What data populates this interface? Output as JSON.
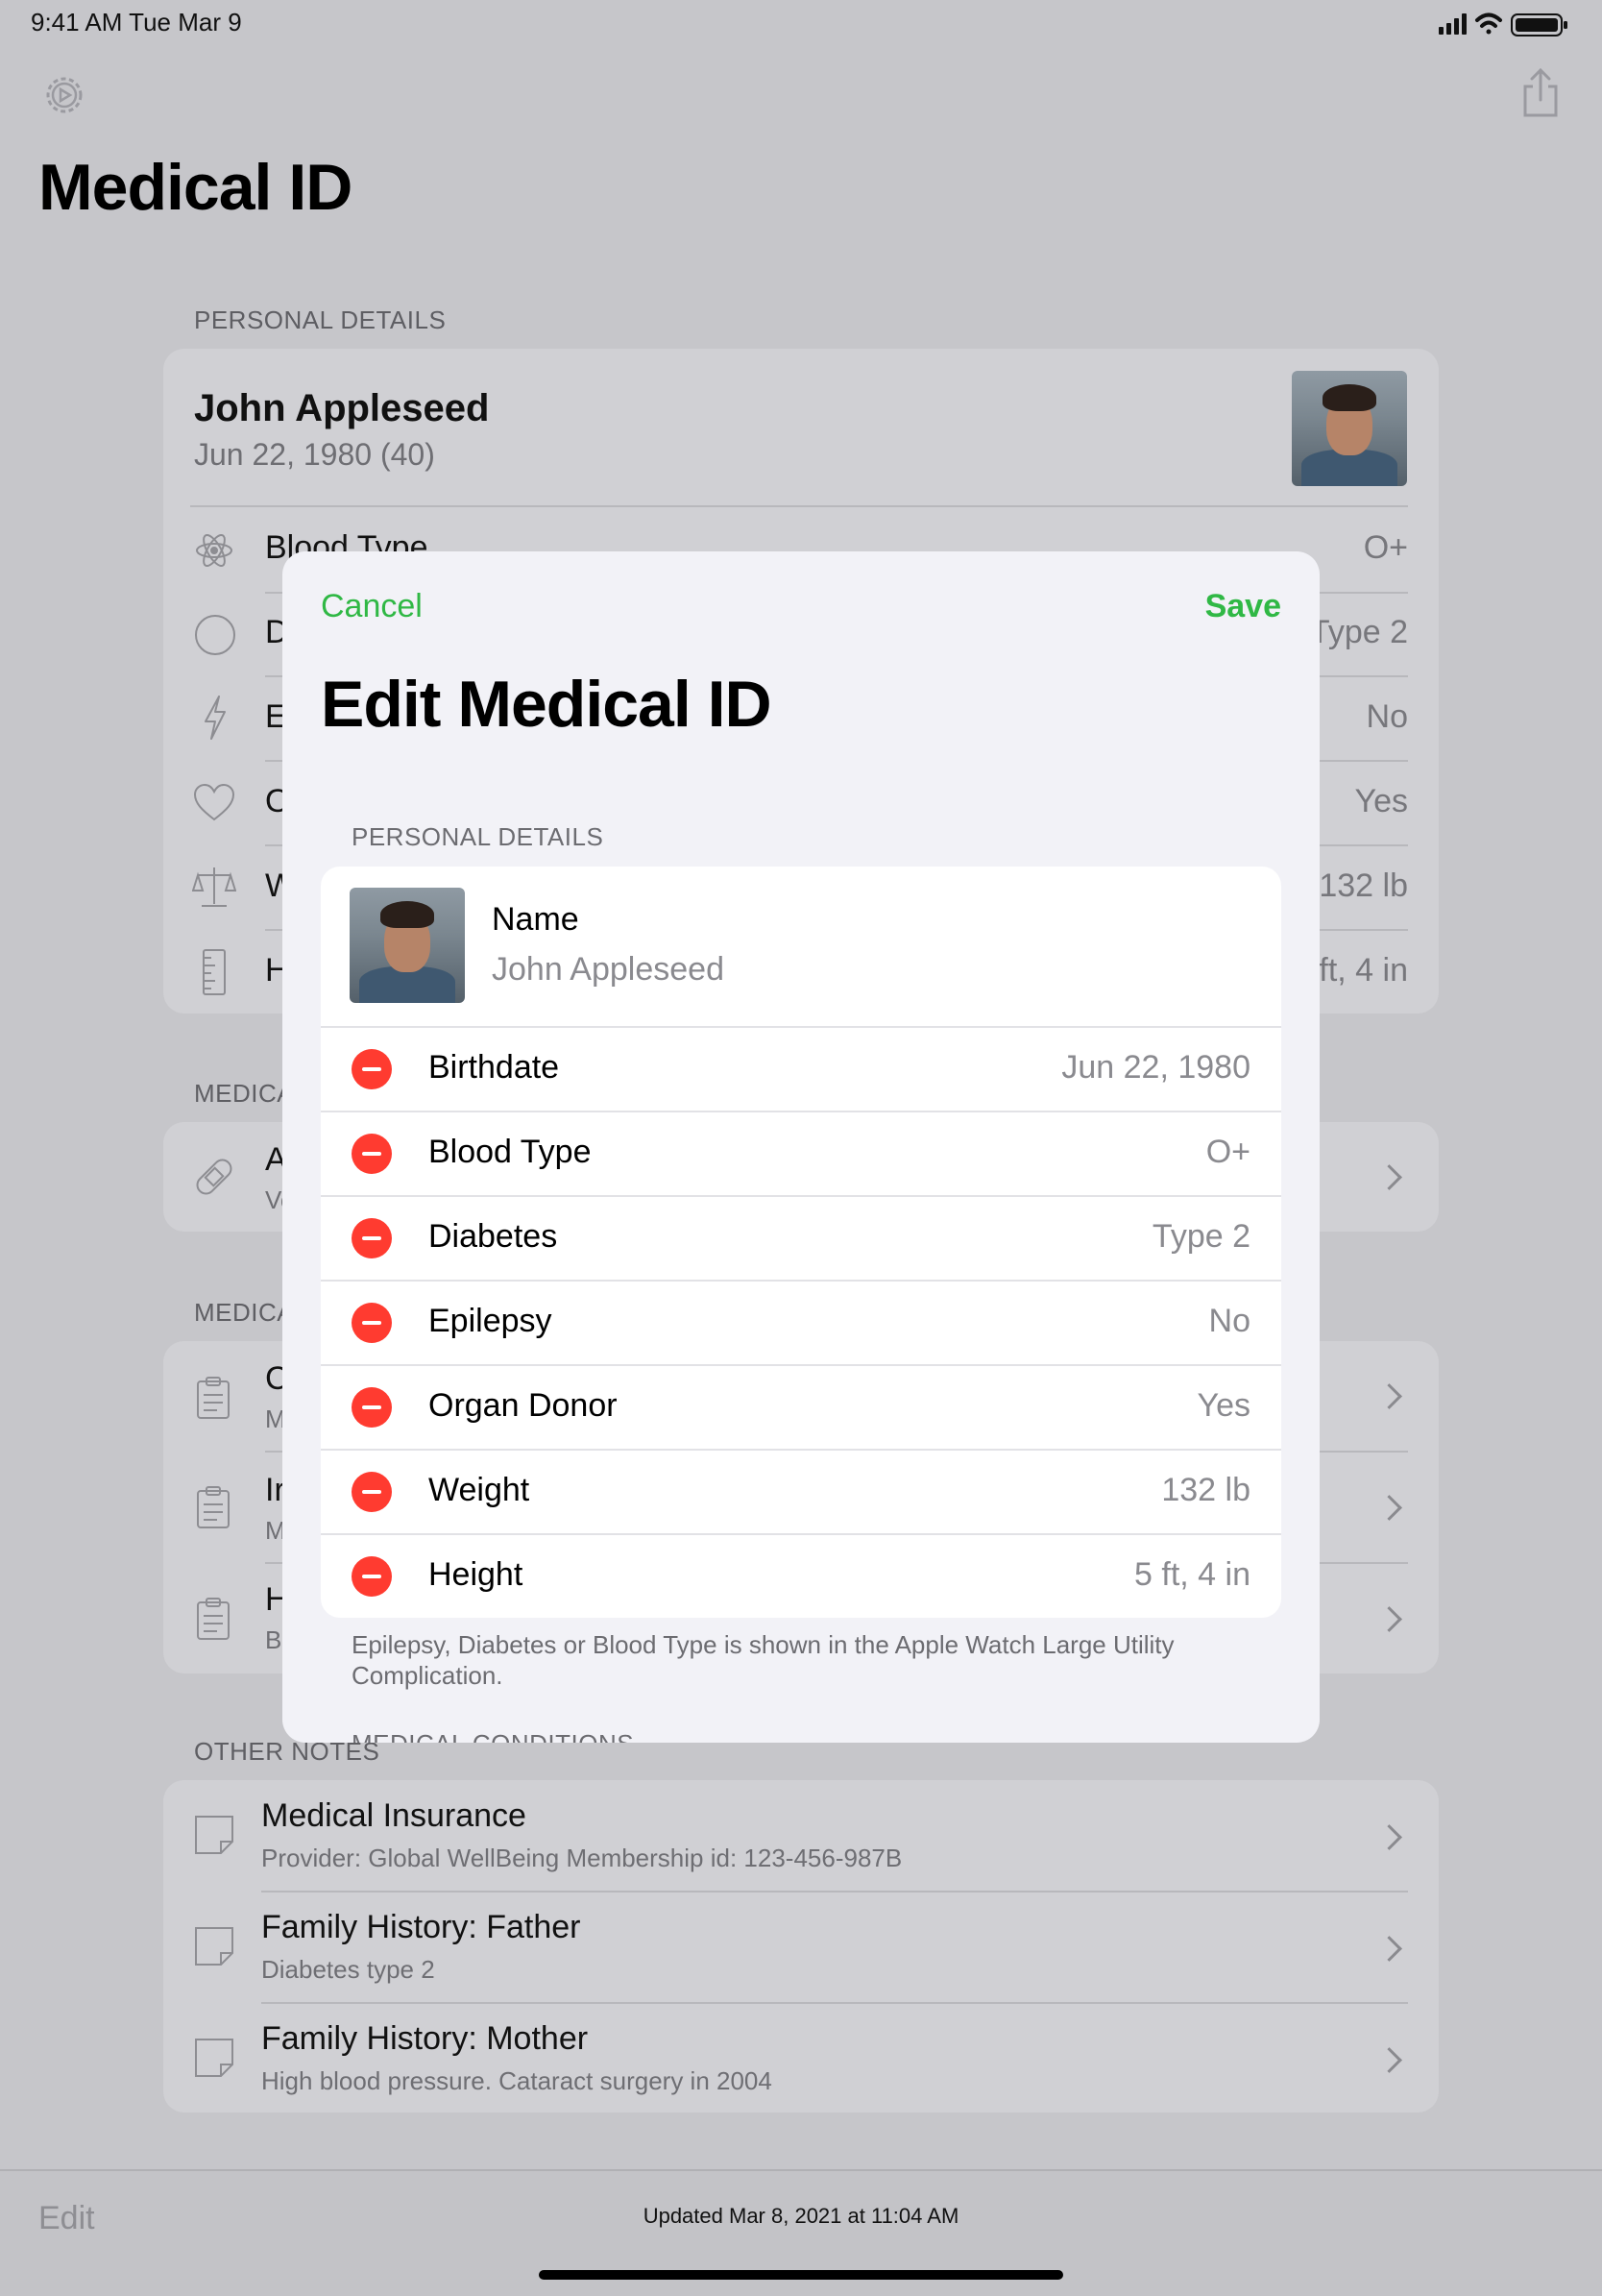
{
  "status_bar": {
    "time_date": "9:41 AM   Tue Mar 9"
  },
  "page": {
    "title": "Medical ID"
  },
  "personal_details": {
    "heading": "PERSONAL DETAILS",
    "name": "John Appleseed",
    "birth": "Jun 22, 1980 (40)",
    "rows": [
      {
        "label": "Blood Type",
        "value": "O+"
      },
      {
        "label": "D",
        "value": "Type 2"
      },
      {
        "label": "E",
        "value": "No"
      },
      {
        "label": "O",
        "value": "Yes"
      },
      {
        "label": "W",
        "value": "132 lb"
      },
      {
        "label": "H",
        "value": "ft, 4 in"
      }
    ]
  },
  "medications": {
    "heading": "MEDICA",
    "item_title": "A",
    "item_sub": "Ve"
  },
  "conditions": {
    "heading": "MEDICA",
    "items": [
      {
        "title": "C",
        "sub": "M"
      },
      {
        "title": "Ir",
        "sub": "M"
      },
      {
        "title": "H",
        "sub": "B"
      }
    ]
  },
  "other_notes": {
    "heading": "OTHER NOTES",
    "items": [
      {
        "title": "Medical Insurance",
        "sub": "Provider: Global WellBeing Membership id: 123-456-987B"
      },
      {
        "title": "Family History: Father",
        "sub": "Diabetes type 2"
      },
      {
        "title": "Family History: Mother",
        "sub": "High blood pressure. Cataract surgery in 2004"
      }
    ]
  },
  "footer": {
    "edit": "Edit",
    "updated": "Updated Mar 8, 2021 at 11:04 AM"
  },
  "modal": {
    "cancel": "Cancel",
    "save": "Save",
    "title": "Edit Medical ID",
    "section_heading": "PERSONAL DETAILS",
    "name_label": "Name",
    "name_value": "John Appleseed",
    "rows": [
      {
        "label": "Birthdate",
        "value": "Jun 22, 1980"
      },
      {
        "label": "Blood Type",
        "value": "O+"
      },
      {
        "label": "Diabetes",
        "value": "Type 2"
      },
      {
        "label": "Epilepsy",
        "value": "No"
      },
      {
        "label": "Organ Donor",
        "value": "Yes"
      },
      {
        "label": "Weight",
        "value": "132 lb"
      },
      {
        "label": "Height",
        "value": "5 ft, 4 in"
      }
    ],
    "footnote": "Epilepsy, Diabetes or Blood Type is shown in the Apple Watch Large Utility Complication.",
    "next_section": "MEDICAL CONDITIONS"
  },
  "colors": {
    "accent_green": "#30b845",
    "delete_red": "#ff3b30"
  }
}
